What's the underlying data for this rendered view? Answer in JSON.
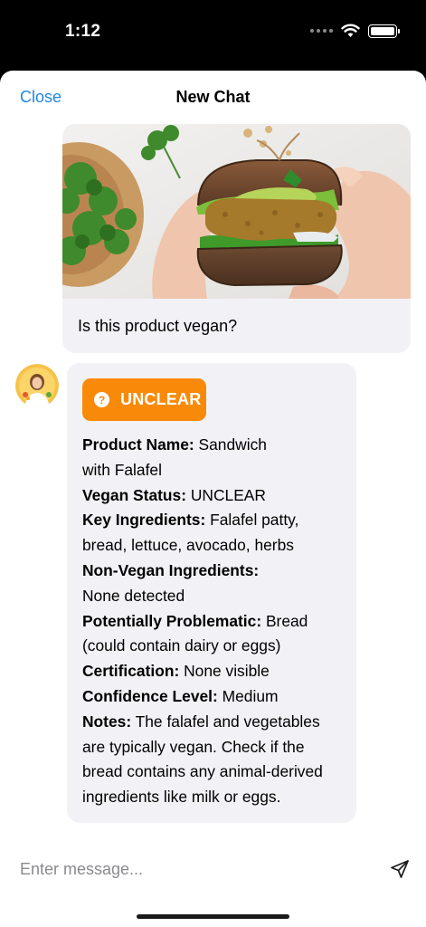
{
  "status_bar": {
    "time": "1:12",
    "icons": [
      "signal-dots-icon",
      "wifi-icon",
      "battery-icon"
    ]
  },
  "nav": {
    "close_label": "Close",
    "title": "New Chat"
  },
  "conversation": {
    "user_message": {
      "image": "falafel-sandwich-photo",
      "text": "Is this product vegan?"
    },
    "assistant_message": {
      "avatar": "assistant-avatar",
      "badge": {
        "icon": "question-mark-icon",
        "label": "UNCLEAR",
        "color": "#f98a09"
      },
      "fields": [
        {
          "label": "Product Name:",
          "value": "Sandwich"
        },
        {
          "label": "",
          "value": "with Falafel"
        },
        {
          "label": "Vegan Status:",
          "value": "UNCLEAR"
        },
        {
          "label": "Key Ingredients:",
          "value": "Falafel patty,"
        },
        {
          "label": "",
          "value": "bread, lettuce, avocado, herbs"
        },
        {
          "label": "Non-Vegan Ingredients:",
          "value": ""
        },
        {
          "label": "",
          "value": "None detected"
        },
        {
          "label": "Potentially Problematic:",
          "value": "Bread"
        },
        {
          "label": "",
          "value": "(could contain dairy or eggs)"
        },
        {
          "label": "Certification:",
          "value": "None visible"
        },
        {
          "label": "Confidence Level:",
          "value": "Medium"
        },
        {
          "label": "Notes:",
          "value": "The falafel and vegetables"
        },
        {
          "label": "",
          "value": "are typically vegan. Check if the"
        },
        {
          "label": "",
          "value": "bread contains any animal-derived"
        },
        {
          "label": "",
          "value": "ingredients like milk or eggs."
        }
      ]
    }
  },
  "composer": {
    "placeholder": "Enter message...",
    "send_icon": "send-icon"
  },
  "colors": {
    "accent": "#1f86e6",
    "bubble": "#f2f2f6",
    "badge": "#f98a09"
  }
}
